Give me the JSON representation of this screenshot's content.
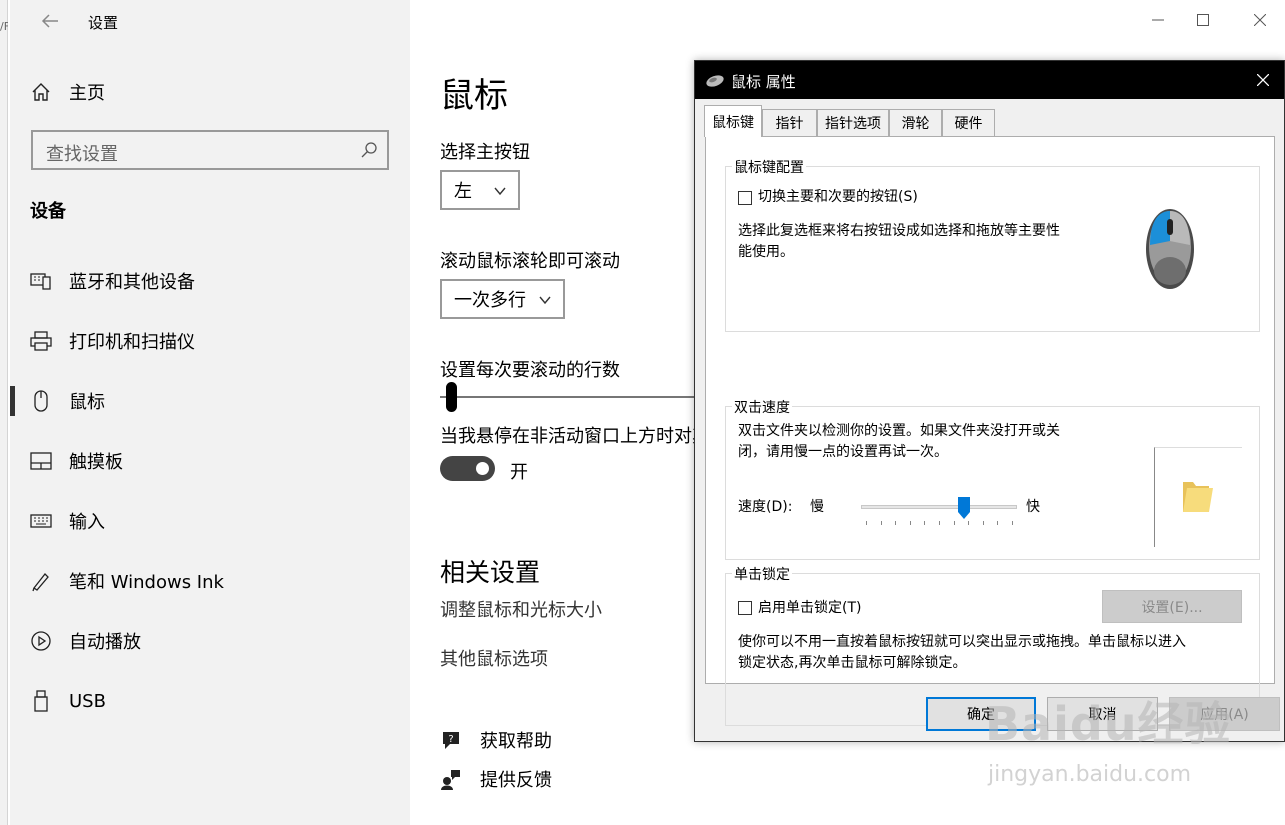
{
  "app": {
    "title": "设置"
  },
  "stub": {
    "text": "/F"
  },
  "sidebar": {
    "home_label": "主页",
    "search_placeholder": "查找设置",
    "section_title": "设备",
    "items": [
      {
        "label": "蓝牙和其他设备",
        "icon": "bluetooth-devices-icon"
      },
      {
        "label": "打印机和扫描仪",
        "icon": "printer-icon"
      },
      {
        "label": "鼠标",
        "icon": "mouse-icon",
        "selected": true
      },
      {
        "label": "触摸板",
        "icon": "touchpad-icon"
      },
      {
        "label": "输入",
        "icon": "keyboard-icon"
      },
      {
        "label": "笔和 Windows Ink",
        "icon": "pen-icon"
      },
      {
        "label": "自动播放",
        "icon": "autoplay-icon"
      },
      {
        "label": "USB",
        "icon": "usb-icon"
      }
    ]
  },
  "main": {
    "page_title": "鼠标",
    "primary_button_label": "选择主按钮",
    "primary_button_value": "左",
    "scroll_label": "滚动鼠标滚轮即可滚动",
    "scroll_value": "一次多行",
    "lines_label": "设置每次要滚动的行数",
    "hover_label": "当我悬停在非活动窗口上方时对其",
    "toggle_state": "开",
    "related_title": "相关设置",
    "related_links": [
      "调整鼠标和光标大小",
      "其他鼠标选项"
    ],
    "help_links": [
      {
        "label": "获取帮助",
        "icon": "help-icon"
      },
      {
        "label": "提供反馈",
        "icon": "feedback-icon"
      }
    ]
  },
  "dialog": {
    "title": "鼠标 属性",
    "tabs": [
      "鼠标键",
      "指针",
      "指针选项",
      "滑轮",
      "硬件"
    ],
    "active_tab": "鼠标键",
    "group1": {
      "title": "鼠标键配置",
      "checkbox_label": "切换主要和次要的按钮(S)",
      "description": [
        "选择此复选框来将右按钮设成如选择和拖放等主要性",
        "能使用。"
      ]
    },
    "group2": {
      "title": "双击速度",
      "description": [
        "双击文件夹以检测你的设置。如果文件夹没打开或关",
        "闭，请用慢一点的设置再试一次。"
      ],
      "speed_label": "速度(D):",
      "slow_label": "慢",
      "fast_label": "快",
      "speed_level": 0.67
    },
    "group3": {
      "title": "单击锁定",
      "checkbox_label": "启用单击锁定(T)",
      "settings_button": "设置(E)...",
      "description": [
        "使你可以不用一直按着鼠标按钮就可以突出显示或拖拽。单击鼠标以进入",
        "锁定状态,再次单击鼠标可解除锁定。"
      ]
    },
    "buttons": {
      "ok": "确定",
      "cancel": "取消",
      "apply": "应用(A)"
    }
  },
  "watermark": {
    "text": "Baidu经验",
    "sub": "jingyan.baidu.com"
  }
}
